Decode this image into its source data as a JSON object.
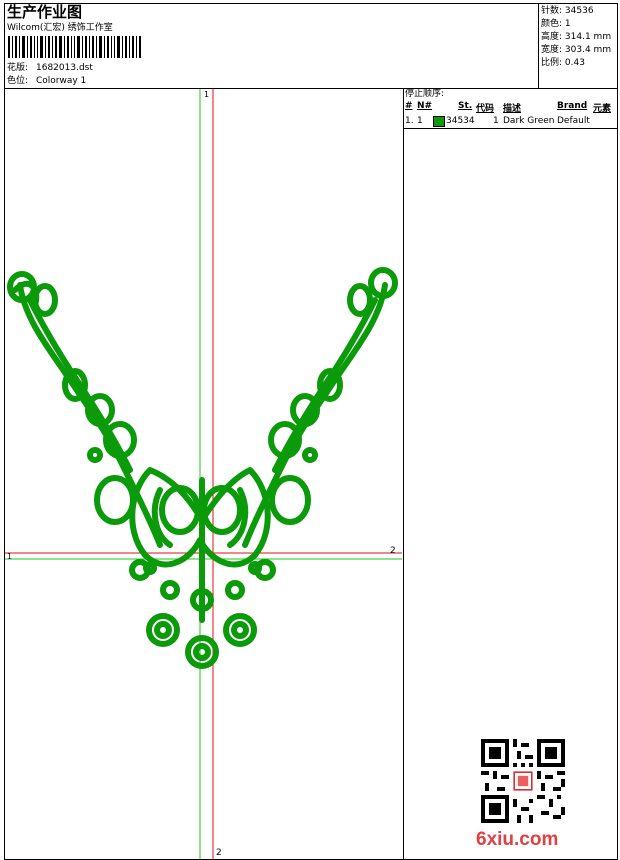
{
  "header": {
    "title": "生产作业图",
    "company": "Wilcom(汇宏) 绣饰工作室",
    "design_label": "花版:",
    "design_value": "1682013.dst",
    "colorway_label": "色位:",
    "colorway_value": "Colorway 1"
  },
  "stats": [
    {
      "label": "针数:",
      "value": "34536"
    },
    {
      "label": "颜色:",
      "value": "1"
    },
    {
      "label": "高度:",
      "value": "314.1 mm"
    },
    {
      "label": "宽度:",
      "value": "303.4 mm"
    },
    {
      "label": "比例:",
      "value": "0.43"
    }
  ],
  "stop_sequence": {
    "title": "停止顺序:",
    "headers": [
      "#",
      "N#",
      "St.",
      "代码",
      "描述",
      "Brand",
      "元素"
    ],
    "rows": [
      {
        "index": "1.",
        "n": "1",
        "swatch_color": "#0a9a0a",
        "stitches": "34534",
        "code": "1",
        "description": "Dark Green",
        "brand": "Default",
        "element": ""
      }
    ]
  },
  "design": {
    "thread_color": "#0a9a0a",
    "axis_markers": {
      "top": "1",
      "left": "1",
      "right": "2",
      "bottom": "2"
    }
  },
  "watermark": {
    "text": "6xiu.com"
  }
}
